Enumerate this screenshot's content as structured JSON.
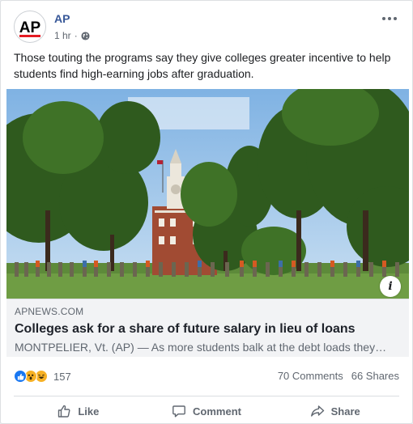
{
  "post": {
    "page_name": "AP",
    "timestamp": "1 hr",
    "separator": "·",
    "text": "Those touting the programs say they give colleges greater incentive to help students find high-earning jobs after graduation."
  },
  "avatar": {
    "logo_text": "AP"
  },
  "link": {
    "domain": "APNEWS.COM",
    "headline": "Colleges ask for a share of future salary in lieu of loans",
    "description": "MONTPELIER, Vt. (AP) — As more students balk at the debt loads they…",
    "info_icon": "i"
  },
  "stats": {
    "reaction_count": "157",
    "comments": "70 Comments",
    "shares": "66 Shares"
  },
  "actions": {
    "like_label": "Like",
    "comment_label": "Comment",
    "share_label": "Share"
  },
  "icons": {
    "globe": "globe-icon",
    "more": "more-horizontal-icon",
    "like": "thumbs-up-icon",
    "comment": "comment-bubble-icon",
    "share": "share-arrow-icon"
  },
  "colors": {
    "page_name": "#385898",
    "like_reaction": "#1877f2",
    "wow_reaction": "#f7b125"
  }
}
